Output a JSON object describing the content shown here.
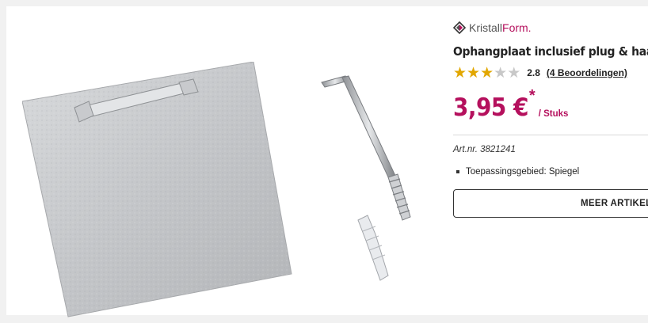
{
  "product": {
    "brand": {
      "part1": "Kristall",
      "part2": "Form."
    },
    "title": "Ophangplaat inclusief plug & haak",
    "rating": {
      "score": "2.8",
      "stars_filled": 3,
      "stars_total": 5,
      "reviews_label": "(4 Beoordelingen)"
    },
    "price": {
      "value": "3,95 €",
      "asterisk": "*",
      "unit": "/ Stuks"
    },
    "article_number": "Art.nr. 3821241",
    "features": [
      "Toepassingsgebied: Spiegel"
    ],
    "more_button": "MEER ARTIKELEN"
  },
  "colors": {
    "accent": "#b5105d",
    "star": "#e2a700",
    "star_off": "#c8c8c8"
  },
  "icons": {
    "brand": "kristallform-logo-icon",
    "star": "star-icon"
  }
}
